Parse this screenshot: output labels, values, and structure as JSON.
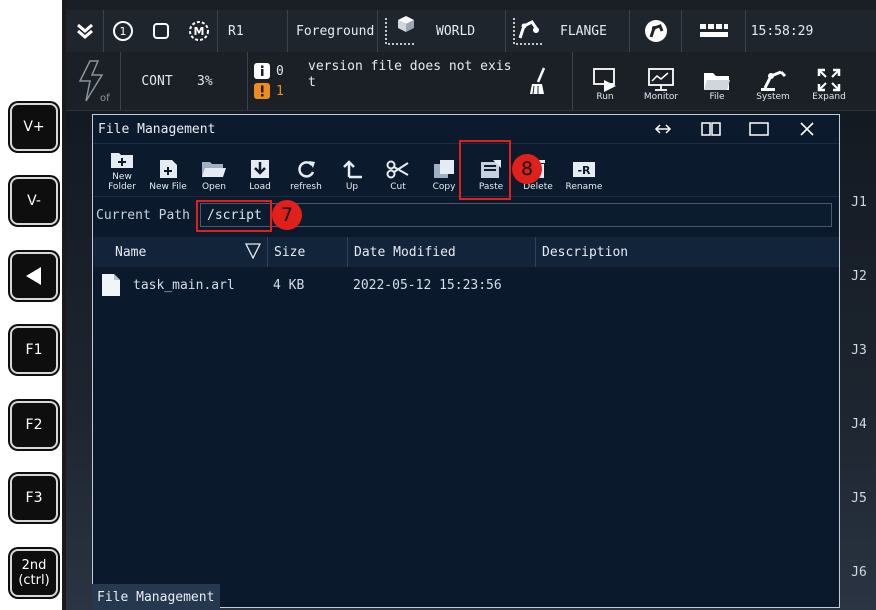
{
  "pendant": {
    "keys": [
      "V+",
      "V-",
      "",
      "F1",
      "F2",
      "F3",
      "2nd\n(ctrl)"
    ]
  },
  "statusbar": {
    "robot": "R1",
    "mode": "Foreground",
    "coord": "WORLD",
    "tool": "FLANGE",
    "time": "15:58:29"
  },
  "second_bar": {
    "run_mode": "CONT",
    "speed": "3%",
    "info_count": "0",
    "warn_count": "1",
    "message": "version file does not exist",
    "buttons": [
      "Run",
      "Monitor",
      "File",
      "System",
      "Expand"
    ]
  },
  "window": {
    "title": "File Management",
    "toolbar": [
      "New Folder",
      "New File",
      "Open",
      "Load",
      "refresh",
      "Up",
      "Cut",
      "Copy",
      "Paste",
      "Delete",
      "Rename"
    ],
    "path_label": "Current Path",
    "path": "/script",
    "columns": [
      "Name",
      "Size",
      "Date Modified",
      "Description"
    ],
    "rows": [
      {
        "name": "task_main.arl",
        "size": "4 KB",
        "date": "2022-05-12 15:23:56",
        "description": ""
      }
    ]
  },
  "callouts": {
    "path_step": "7",
    "paste_step": "8"
  },
  "joints": [
    "J1",
    "J2",
    "J3",
    "J4",
    "J5",
    "J6"
  ],
  "taskbar": {
    "label": "File Management"
  },
  "colors": {
    "accent": "#e0201a",
    "window_bg": "#0a1a2c",
    "warn": "#f08c1e"
  }
}
